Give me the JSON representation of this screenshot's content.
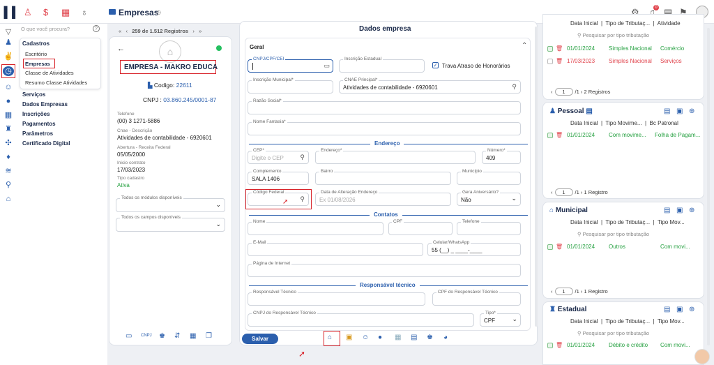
{
  "topbar": {
    "title": "Empresas",
    "search_placeholder": "O que você procura?",
    "notif_count": "0",
    "pager_text": "259 de 1.512 Registros"
  },
  "menu": {
    "cadastros": "Cadastros",
    "items": [
      "Escritório",
      "Empresas",
      "Classe de Atividades",
      "Resumo Classe Atividades"
    ],
    "sections": [
      "Serviços",
      "Dados Empresas",
      "Inscrições",
      "Pagamentos",
      "Parâmetros",
      "Certificado Digital"
    ]
  },
  "company": {
    "name": "EMPRESA - MAKRO EDUCA",
    "code_label": "Codigo:",
    "code": "22611",
    "cnpj_label": "CNPJ :",
    "cnpj": "03.860.245/0001-87",
    "fields": [
      {
        "label": "Telefone",
        "value": "(00) 3 1271-5886"
      },
      {
        "label": "Cnae - Descrição",
        "value": "Atividades de contabilidade - 6920601"
      },
      {
        "label": "Abertura - Receita Federal",
        "value": "05/05/2000"
      },
      {
        "label": "Inicio contrato",
        "value": "17/03/2023"
      },
      {
        "label": "Tipo cadastro",
        "value": "Ativa"
      }
    ],
    "select_modulos": "Todos os módulos disponíveis",
    "select_campos": "Todos os campos disponíveis"
  },
  "form": {
    "title": "Dados empresa",
    "group": "Geral",
    "cnpj_label": "CNPJ/CPF/CEI",
    "ie_label": "Inscrição Estadual",
    "trava_label": "Trava Atraso de Honorários",
    "im_label": "Inscrição Municipal*",
    "cnae_label": "CNAE Principal*",
    "cnae_value": "Atividades de contabilidade - 6920601",
    "razao_label": "Razão Social*",
    "fantasia_label": "Nome Fantasia*",
    "endereco_section": "Endereço",
    "cep_label": "CEP*",
    "cep_placeholder": "Digite o CEP",
    "endereco_label": "Endereço*",
    "numero_label": "Número*",
    "numero_value": "409",
    "complemento_label": "Complemento",
    "complemento_value": "SALA 1406",
    "bairro_label": "Bairro",
    "municipio_label": "Município",
    "cod_federal_label": "Código Federal",
    "data_alt_label": "Data de Alteração Endereço",
    "data_alt_placeholder": "Ex 01/08/2026",
    "gera_aniv_label": "Gera Aniversário?",
    "gera_aniv_value": "Não",
    "contatos_section": "Contatos",
    "nome_label": "Nome",
    "cpf_label": "CPF",
    "telefone_label": "Telefone",
    "email_label": "E-Mail",
    "celular_label": "Celular/WhatsApp",
    "celular_value": "55 (__) _ ____-____",
    "pagina_label": "Página de Internet",
    "resp_section": "Responsável técnico",
    "resp_label": "Responsável Técnico",
    "cpf_resp_label": "CPF do Responsável Técnico",
    "cnpj_resp_label": "CNPJ do Responsável Técnico",
    "tipo_label": "Tipo*",
    "tipo_value": "CPF",
    "save": "Salvar"
  },
  "cards": {
    "federal": {
      "headers": [
        "Data Inicial",
        "Tipo de Tributaç...",
        "Atividade"
      ],
      "search": "Pesquisar por tipo tributação",
      "rows": [
        {
          "date": "01/01/2024",
          "tipo": "Simples Nacional",
          "ativ": "Comércio",
          "color": "green"
        },
        {
          "date": "17/03/2023",
          "tipo": "Simples Nacional",
          "ativ": "Serviços",
          "color": "red"
        }
      ],
      "page": "1",
      "total": "/1",
      "registros": "2 Registros"
    },
    "pessoal": {
      "title": "Pessoal",
      "headers": [
        "Data Inicial",
        "Tipo Movime...",
        "Bc Patronal"
      ],
      "rows": [
        {
          "date": "01/01/2024",
          "tipo": "Com movime...",
          "ativ": "Folha de Pagam..."
        }
      ],
      "page": "1",
      "total": "/1",
      "registros": "1 Registro"
    },
    "municipal": {
      "title": "Municipal",
      "headers": [
        "Data Inicial",
        "Tipo de Tributaç...",
        "Tipo Mov..."
      ],
      "search": "Pesquisar por tipo tributação",
      "rows": [
        {
          "date": "01/01/2024",
          "tipo": "Outros",
          "ativ": "Com movi..."
        }
      ],
      "page": "1",
      "total": "/1",
      "registros": "1 Registro"
    },
    "estadual": {
      "title": "Estadual",
      "headers": [
        "Data Inicial",
        "Tipo de Tributaç...",
        "Tipo Mov..."
      ],
      "search": "Pesquisar por tipo tributação",
      "rows": [
        {
          "date": "01/01/2024",
          "tipo": "Débito e crédito",
          "ativ": "Com movi..."
        }
      ]
    }
  },
  "colors": {
    "accent": "#2b5fad",
    "highlight": "#d8232a",
    "ok": "#25a040",
    "danger": "#e0424b"
  }
}
